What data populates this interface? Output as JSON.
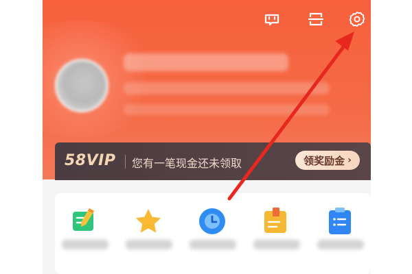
{
  "header": {
    "icons": [
      {
        "name": "customer-service-icon"
      },
      {
        "name": "scan-icon"
      },
      {
        "name": "settings-icon"
      }
    ]
  },
  "vip_banner": {
    "logo": "58VIP",
    "message": "您有一笔现金还未领取",
    "button_label": "领奖励金",
    "button_chevron": "›"
  },
  "shortcuts": [
    {
      "icon": "notebook-pencil-icon",
      "color": "#2fc57a"
    },
    {
      "icon": "star-icon",
      "color": "#f9b935"
    },
    {
      "icon": "clock-icon",
      "color": "#2f8cf3"
    },
    {
      "icon": "folder-icon",
      "color": "#f6b733"
    },
    {
      "icon": "clipboard-list-icon",
      "color": "#2f86f4"
    }
  ],
  "colors": {
    "header_bg": "#f6603c",
    "banner_bg": "#4a3c40",
    "annotation_arrow": "#e8281f"
  }
}
